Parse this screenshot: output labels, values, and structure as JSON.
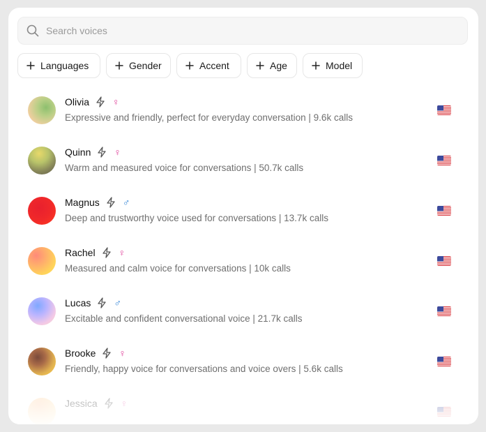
{
  "search": {
    "placeholder": "Search voices",
    "value": ""
  },
  "filters": [
    {
      "label": "Languages"
    },
    {
      "label": "Gender"
    },
    {
      "label": "Accent"
    },
    {
      "label": "Age"
    },
    {
      "label": "Model"
    }
  ],
  "voices": [
    {
      "name": "Olivia",
      "gender": "♀",
      "description": "Expressive and friendly, perfect for everyday conversation | 9.6k calls",
      "flag": "us-flag"
    },
    {
      "name": "Quinn",
      "gender": "♀",
      "description": "Warm and measured voice for conversations | 50.7k calls",
      "flag": "us-flag"
    },
    {
      "name": "Magnus",
      "gender": "♂",
      "description": "Deep and trustworthy voice used for conversations | 13.7k calls",
      "flag": "us-flag"
    },
    {
      "name": "Rachel",
      "gender": "♀",
      "description": "Measured and calm voice for conversations | 10k calls",
      "flag": "us-flag"
    },
    {
      "name": "Lucas",
      "gender": "♂",
      "description": "Excitable and confident conversational voice | 21.7k calls",
      "flag": "us-flag"
    },
    {
      "name": "Brooke",
      "gender": "♀",
      "description": "Friendly, happy voice for conversations and voice overs | 5.6k calls",
      "flag": "us-flag"
    },
    {
      "name": "Jessica",
      "gender": "♀",
      "description": "",
      "flag": "us-flag"
    }
  ],
  "colors": {
    "female": "#e0409a",
    "male": "#2a7fd4",
    "muted_text": "#6f6f6f"
  }
}
